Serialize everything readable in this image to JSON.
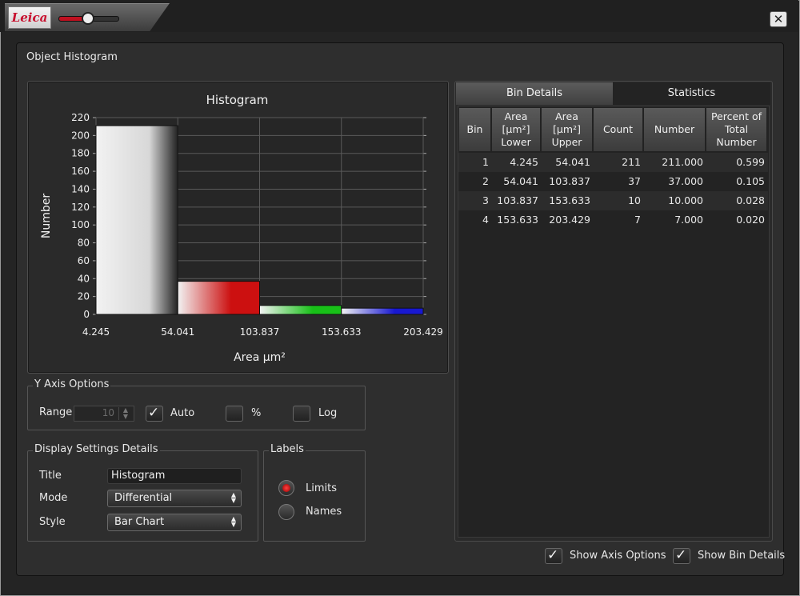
{
  "window": {
    "logo_text": "Leica",
    "close_glyph": "✕",
    "zoom_slider_value": 0.5
  },
  "panel_title": "Object Histogram",
  "chart_data": {
    "type": "bar",
    "title": "Histogram",
    "xlabel": "Area µm²",
    "ylabel": "Number",
    "x_ticks": [
      "4.245",
      "54.041",
      "103.837",
      "153.633",
      "203.429"
    ],
    "y_ticks": [
      0,
      20,
      40,
      60,
      80,
      100,
      120,
      140,
      160,
      180,
      200,
      220
    ],
    "ylim": [
      0,
      220
    ],
    "bins": [
      {
        "lower": 4.245,
        "upper": 54.041,
        "value": 211,
        "color": "#d8d8d8"
      },
      {
        "lower": 54.041,
        "upper": 103.837,
        "value": 37,
        "color": "#cc1010"
      },
      {
        "lower": 103.837,
        "upper": 153.633,
        "value": 10,
        "color": "#18c018"
      },
      {
        "lower": 153.633,
        "upper": 203.429,
        "value": 7,
        "color": "#1818d0"
      }
    ],
    "grid": true
  },
  "y_axis_options": {
    "group_label": "Y Axis Options",
    "range_label": "Range",
    "range_value": "10",
    "auto_label": "Auto",
    "auto_checked": true,
    "percent_label": "%",
    "percent_checked": false,
    "log_label": "Log",
    "log_checked": false
  },
  "display_settings": {
    "group_label": "Display Settings Details",
    "title_label": "Title",
    "title_value": "Histogram",
    "mode_label": "Mode",
    "mode_value": "Differential",
    "style_label": "Style",
    "style_value": "Bar Chart"
  },
  "labels": {
    "group_label": "Labels",
    "limits_label": "Limits",
    "names_label": "Names",
    "selected": "Limits"
  },
  "tabs": [
    {
      "label": "Bin Details",
      "active": true
    },
    {
      "label": "Statistics",
      "active": false
    }
  ],
  "table": {
    "headers": [
      "Bin",
      "Area [µm²] Lower",
      "Area [µm²] Upper",
      "Count",
      "Number",
      "Percent of Total Number"
    ],
    "rows": [
      [
        "1",
        "4.245",
        "54.041",
        "211",
        "211.000",
        "0.599"
      ],
      [
        "2",
        "54.041",
        "103.837",
        "37",
        "37.000",
        "0.105"
      ],
      [
        "3",
        "103.837",
        "153.633",
        "10",
        "10.000",
        "0.028"
      ],
      [
        "4",
        "153.633",
        "203.429",
        "7",
        "7.000",
        "0.020"
      ]
    ]
  },
  "footer": {
    "show_axis_options_label": "Show Axis Options",
    "show_axis_options_checked": true,
    "show_bin_details_label": "Show Bin Details",
    "show_bin_details_checked": true
  }
}
